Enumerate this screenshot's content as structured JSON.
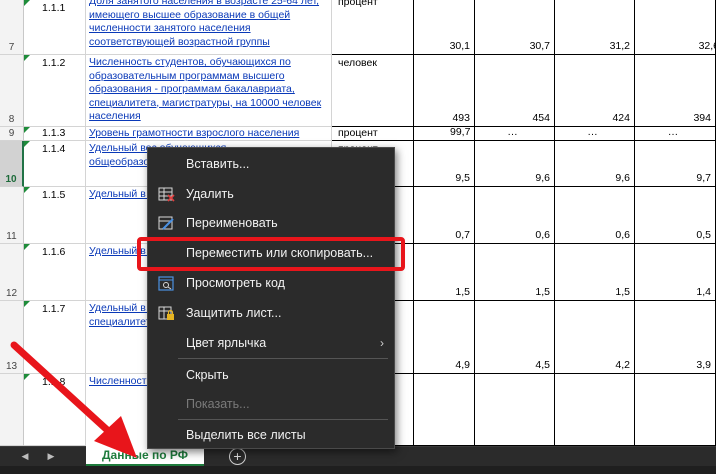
{
  "sheet": {
    "rows": [
      {
        "row": "7",
        "num": "1.1.1",
        "name": "Доля занятого населения в возрасте 25-64 лет, имеющего высшее образование в общей численности занятого населения соответствующей возрастной группы",
        "unit": "процент",
        "values": [
          "30,1",
          "30,7",
          "31,2",
          "32,6"
        ]
      },
      {
        "row": "8",
        "num": "1.1.2",
        "name": "Численность студентов, обучающихся по образовательным программам высшего образования - программам бакалавриата, специалитета, магистратуры, на 10000 человек населения",
        "unit": "человек",
        "values": [
          "493",
          "454",
          "424",
          "394"
        ]
      },
      {
        "row": "9",
        "num": "1.1.3",
        "name": "Уровень грамотности взрослого населения",
        "unit": "процент",
        "values": [
          "99,7",
          "…",
          "…",
          "…"
        ]
      },
      {
        "row": "10",
        "num": "1.1.4",
        "name": "Удельный вес обучающихся общеобразовательных численност",
        "unit": "процент",
        "values": [
          "9,5",
          "9,6",
          "9,6",
          "9,7"
        ]
      },
      {
        "row": "11",
        "num": "1.1.5",
        "name": "Удельный в программы рабочих, сл населения",
        "unit": "",
        "values": [
          "0,7",
          "0,6",
          "0,6",
          "0,5"
        ]
      },
      {
        "row": "12",
        "num": "1.1.6",
        "name": "Удельный в программ звена, в общ",
        "unit": "",
        "values": [
          "1,5",
          "1,5",
          "1,5",
          "1,4"
        ]
      },
      {
        "row": "13",
        "num": "1.1.7",
        "name": "Удельный в образовател программам специалитет численност",
        "unit": "",
        "values": [
          "4,9",
          "4,5",
          "4,2",
          "3,9"
        ]
      },
      {
        "row": "",
        "num": "1.1.8",
        "name": "Численност государствен высшего об",
        "unit": "",
        "values": [
          "",
          "",
          "",
          ""
        ]
      }
    ]
  },
  "tabs": {
    "active": "Данные по РФ",
    "prev_icon": "◀",
    "next_icon": "▶",
    "add_icon": "+"
  },
  "context_menu": {
    "items": [
      {
        "label": "Вставить...",
        "icon": "",
        "disabled": false
      },
      {
        "label": "Удалить",
        "icon": "delete-sheet-icon",
        "disabled": false
      },
      {
        "label": "Переименовать",
        "icon": "rename-icon",
        "disabled": false
      },
      {
        "label": "Переместить или скопировать...",
        "icon": "",
        "disabled": false,
        "highlighted": true
      },
      {
        "label": "Просмотреть код",
        "icon": "view-code-icon",
        "disabled": false
      },
      {
        "label": "Защитить лист...",
        "icon": "protect-sheet-icon",
        "disabled": false
      },
      {
        "label": "Цвет ярлычка",
        "icon": "",
        "disabled": false,
        "submenu": true
      },
      {
        "label": "Скрыть",
        "icon": "",
        "disabled": false
      },
      {
        "label": "Показать...",
        "icon": "",
        "disabled": true
      },
      {
        "label": "Выделить все листы",
        "icon": "",
        "disabled": false
      }
    ],
    "submenu_arrow": "›"
  },
  "colors": {
    "highlight_border": "#e8151b",
    "arrow": "#e8151b",
    "menu_bg": "#2b2b2b",
    "tab_accent": "#1e7b3c",
    "link_text": "#0a39b8"
  }
}
